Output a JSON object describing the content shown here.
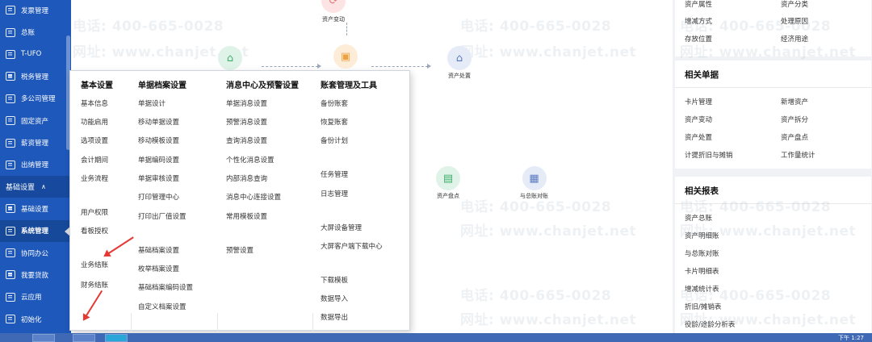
{
  "sidebar": {
    "items_top": [
      {
        "label": "发票管理"
      },
      {
        "label": "总账"
      },
      {
        "label": "T-UFO"
      },
      {
        "label": "税务管理"
      },
      {
        "label": "多公司管理"
      },
      {
        "label": "固定资产"
      },
      {
        "label": "薪资管理"
      },
      {
        "label": "出纳管理"
      }
    ],
    "section": {
      "label": "基础设置",
      "chevron": "∧"
    },
    "items_bottom": [
      {
        "label": "基础设置"
      },
      {
        "label": "系统管理"
      },
      {
        "label": "协同办公"
      },
      {
        "label": "我要贷款"
      },
      {
        "label": "云应用"
      },
      {
        "label": "初始化"
      }
    ]
  },
  "watermark": {
    "phone": "电话: 400-665-0028",
    "site": "网址: www.chanjet.net"
  },
  "flow": {
    "asset_change": "资产变动",
    "asset_dispose": "资产处置",
    "asset_count": "资产盘点",
    "reconcile": "与总账对账"
  },
  "menu": {
    "col1": {
      "title": "基本设置",
      "items": [
        "基本信息",
        "功能启用",
        "选项设置",
        "会计期间",
        "业务流程",
        "用户权限",
        "看板授权",
        "业务结账",
        "财务结账"
      ]
    },
    "col2": {
      "title": "单据档案设置",
      "items": [
        "单据设计",
        "移动单据设置",
        "移动模板设置",
        "单据编码设置",
        "单据审核设置",
        "打印管理中心",
        "打印出厂值设置",
        "基础档案设置",
        "枚举档案设置",
        "基础档案编码设置",
        "自定义档案设置"
      ]
    },
    "col3": {
      "title": "消息中心及预警设置",
      "items": [
        "单据消息设置",
        "预警消息设置",
        "查询消息设置",
        "个性化消息设置",
        "内部消息查询",
        "消息中心连接设置",
        "常用模板设置",
        "预警设置"
      ]
    },
    "col4": {
      "title": "账套管理及工具",
      "items": [
        "备份账套",
        "恢复账套",
        "备份计划",
        "任务管理",
        "日志管理",
        "大屏设备管理",
        "大屏客户端下载中心",
        "下载模板",
        "数据导入",
        "数据导出"
      ]
    }
  },
  "right": {
    "top_items": [
      "资产属性",
      "资产分类",
      "增减方式",
      "处理原因",
      "存放位置",
      "经济用途"
    ],
    "docs": {
      "title": "相关单据",
      "items": [
        "卡片管理",
        "新增资产",
        "资产变动",
        "资产拆分",
        "资产处置",
        "资产盘点",
        "计提折旧与摊销",
        "工作量统计"
      ]
    },
    "reports": {
      "title": "相关报表",
      "items": [
        "资产总账",
        "资产明细账",
        "与总账对账",
        "卡片明细表",
        "增减统计表",
        "折旧/摊销表",
        "役龄/途龄分析表"
      ]
    }
  },
  "taskbar": {
    "clock": "下午 1:27"
  }
}
